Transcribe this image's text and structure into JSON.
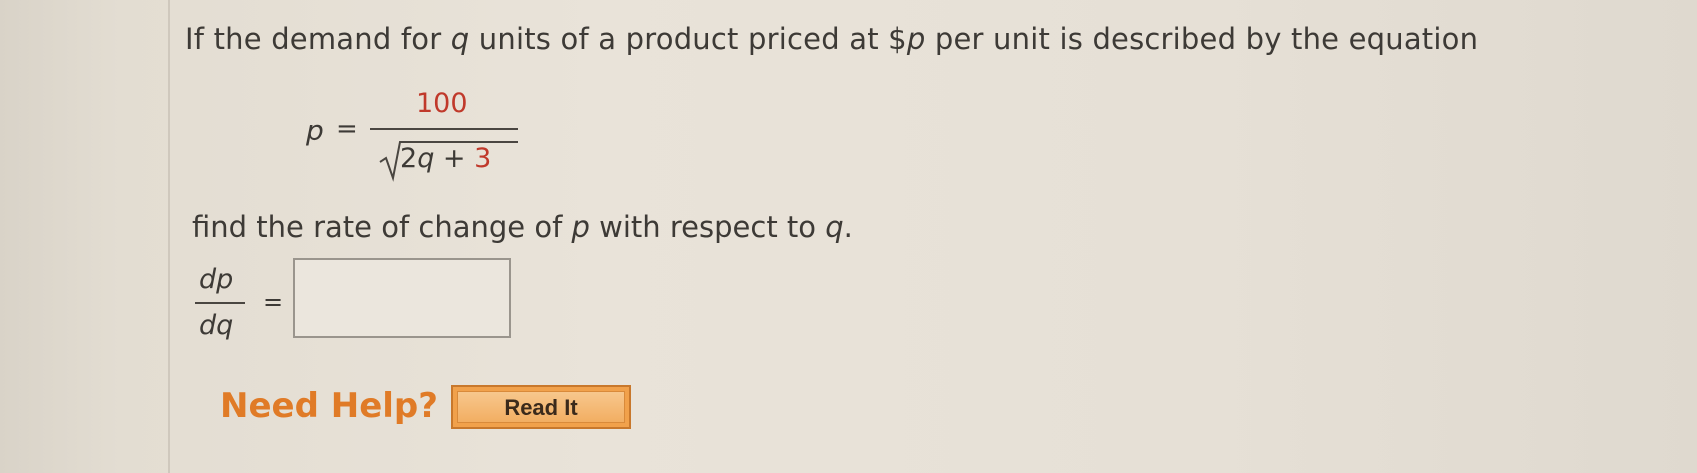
{
  "question": {
    "part1": "If the demand for ",
    "var_q": "q",
    "part2": " units of a product priced at $",
    "var_p": "p",
    "part3": " per unit is described by the equation"
  },
  "equation": {
    "lhs": "p",
    "equals": "=",
    "numerator": "100",
    "denominator_coeff": "2",
    "denominator_var": "q",
    "denominator_op": " + ",
    "denominator_const": "3"
  },
  "instruction": {
    "part1": "find the rate of change of ",
    "var_p": "p",
    "part2": " with respect to ",
    "var_q": "q",
    "part3": "."
  },
  "derivative": {
    "numerator": "dp",
    "denominator": "dq",
    "equals": "="
  },
  "answer": {
    "value": ""
  },
  "help": {
    "label": "Need Help?",
    "read_button": "Read It"
  },
  "colors": {
    "accent_orange": "#e07b27",
    "button_fill": "#f2ae62",
    "highlight_red": "#c0392b"
  }
}
